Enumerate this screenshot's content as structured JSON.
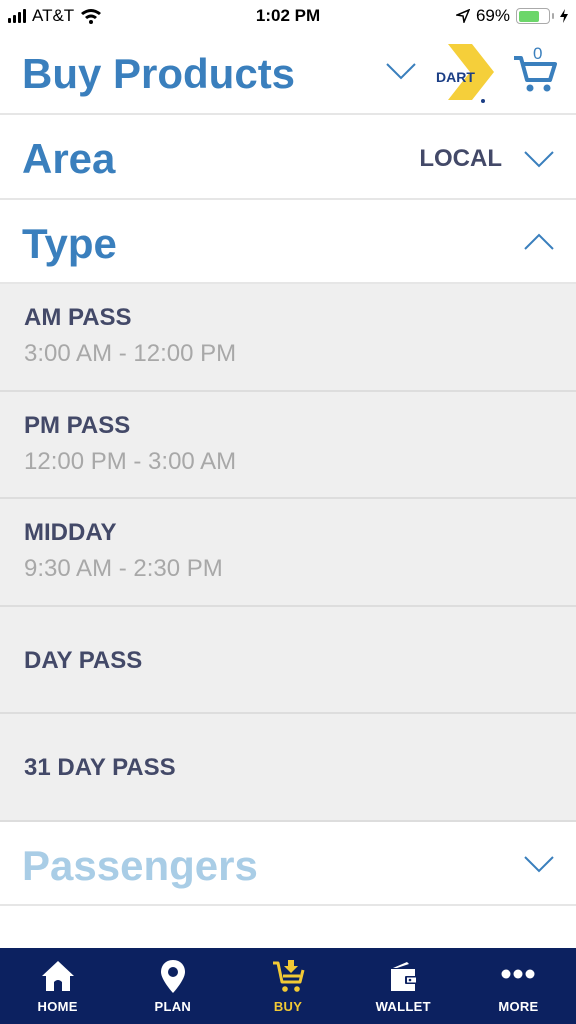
{
  "status_bar": {
    "carrier": "AT&T",
    "time": "1:02 PM",
    "battery_percent": "69%",
    "battery_level": 0.69
  },
  "header": {
    "title": "Buy Products",
    "logo_text": "DART",
    "cart_count": "0"
  },
  "sections": {
    "area": {
      "title": "Area",
      "value": "LOCAL",
      "expanded": false
    },
    "type": {
      "title": "Type",
      "expanded": true
    },
    "passengers": {
      "title": "Passengers",
      "expanded": false
    }
  },
  "type_options": [
    {
      "name": "AM PASS",
      "time": "3:00 AM - 12:00 PM"
    },
    {
      "name": "PM PASS",
      "time": "12:00 PM - 3:00 AM"
    },
    {
      "name": "MIDDAY",
      "time": "9:30 AM - 2:30 PM"
    },
    {
      "name": "DAY PASS",
      "time": ""
    },
    {
      "name": "31 DAY PASS",
      "time": ""
    }
  ],
  "tab_bar": {
    "tabs": [
      {
        "label": "HOME",
        "icon": "home-icon",
        "active": false
      },
      {
        "label": "PLAN",
        "icon": "map-pin-icon",
        "active": false
      },
      {
        "label": "BUY",
        "icon": "cart-download-icon",
        "active": true
      },
      {
        "label": "WALLET",
        "icon": "wallet-icon",
        "active": false
      },
      {
        "label": "MORE",
        "icon": "more-icon",
        "active": false
      }
    ]
  },
  "colors": {
    "primary_blue": "#3a7fbd",
    "light_blue": "#a9cde6",
    "text_dark": "#434968",
    "text_muted": "#a8a8a8",
    "tab_bar_bg": "#0c2160",
    "tab_active": "#f2c935",
    "logo_yellow": "#f5cf3a"
  }
}
